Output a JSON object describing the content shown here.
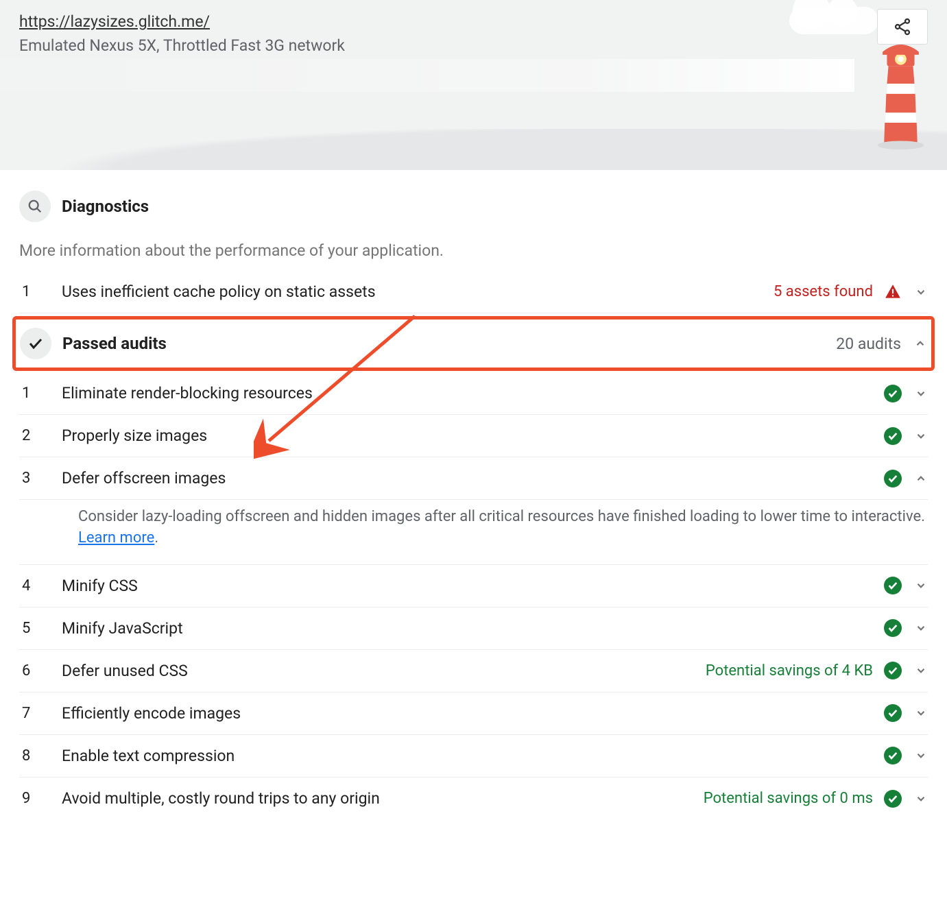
{
  "header": {
    "url": "https://lazysizes.glitch.me/",
    "subtitle": "Emulated Nexus 5X, Throttled Fast 3G network"
  },
  "diagnostics": {
    "title": "Diagnostics",
    "description": "More information about the performance of your application.",
    "items": [
      {
        "num": "1",
        "label": "Uses inefficient cache policy on static assets",
        "meta": "5 assets found",
        "metaColor": "red",
        "icon": "warn",
        "chev": "down"
      }
    ]
  },
  "passed": {
    "title": "Passed audits",
    "count": "20 audits",
    "items": [
      {
        "num": "1",
        "label": "Eliminate render-blocking resources",
        "meta": "",
        "chev": "down"
      },
      {
        "num": "2",
        "label": "Properly size images",
        "meta": "",
        "chev": "down"
      },
      {
        "num": "3",
        "label": "Defer offscreen images",
        "meta": "",
        "chev": "up",
        "expanded": true,
        "detail": "Consider lazy-loading offscreen and hidden images after all critical resources have finished loading to lower time to interactive. ",
        "link": "Learn more"
      },
      {
        "num": "4",
        "label": "Minify CSS",
        "meta": "",
        "chev": "down"
      },
      {
        "num": "5",
        "label": "Minify JavaScript",
        "meta": "",
        "chev": "down"
      },
      {
        "num": "6",
        "label": "Defer unused CSS",
        "meta": "Potential savings of 4 KB",
        "metaColor": "green",
        "chev": "down"
      },
      {
        "num": "7",
        "label": "Efficiently encode images",
        "meta": "",
        "chev": "down"
      },
      {
        "num": "8",
        "label": "Enable text compression",
        "meta": "",
        "chev": "down"
      },
      {
        "num": "9",
        "label": "Avoid multiple, costly round trips to any origin",
        "meta": "Potential savings of 0 ms",
        "metaColor": "green",
        "chev": "down"
      }
    ]
  }
}
